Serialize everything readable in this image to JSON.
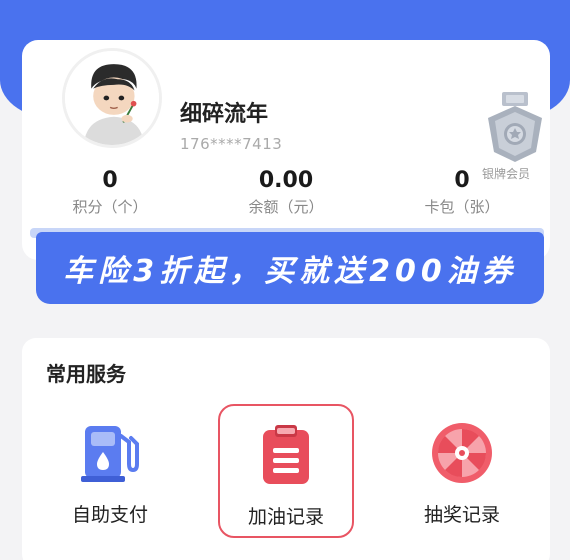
{
  "profile": {
    "username": "细碎流年",
    "phone": "176****7413",
    "member_level": "银牌会员"
  },
  "stats": [
    {
      "value": "0",
      "label": "积分（个）"
    },
    {
      "value": "0.00",
      "label": "余额（元）"
    },
    {
      "value": "0",
      "label": "卡包（张）"
    }
  ],
  "banner": {
    "text": "车险3折起，买就送200油券"
  },
  "services": {
    "title": "常用服务",
    "items": [
      {
        "label": "自助支付",
        "icon": "fuel-pump-icon"
      },
      {
        "label": "加油记录",
        "icon": "clipboard-icon"
      },
      {
        "label": "抽奖记录",
        "icon": "prize-wheel-icon"
      }
    ]
  },
  "colors": {
    "brand_blue": "#4a72ee",
    "highlight_red": "#e85563",
    "fuel_icon_blue": "#5b7cf0",
    "record_icon_red": "#e84d5b"
  }
}
